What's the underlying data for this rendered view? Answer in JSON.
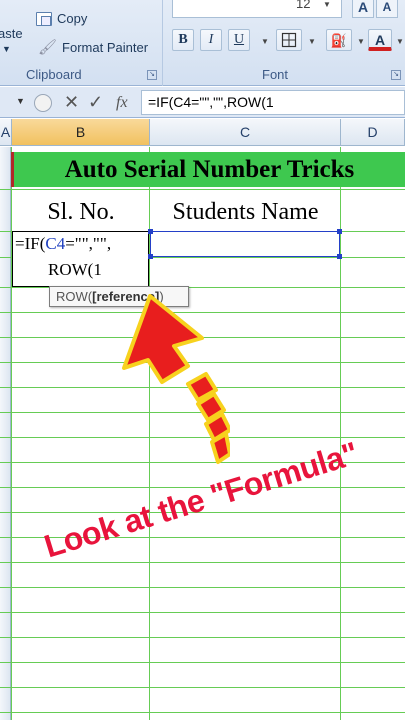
{
  "ribbon": {
    "paste_label": "aste",
    "copy_label": "Copy",
    "format_painter_label": "Format Painter",
    "clipboard_group": "Clipboard",
    "font_size": "12",
    "grow_label": "A",
    "shrink_label": "A",
    "bold_label": "B",
    "italic_label": "I",
    "underline_label": "U",
    "font_color_label": "A",
    "font_group": "Font"
  },
  "formula_bar": {
    "cancel_label": "✕",
    "enter_label": "✓",
    "fx_label": "fx",
    "formula": "=IF(C4=\"\",\"\",ROW(1"
  },
  "columns": [
    "A",
    "B",
    "C",
    "D"
  ],
  "sheet": {
    "title": "Auto Serial Number Tricks",
    "header_sl": "Sl. No.",
    "header_name": "Students Name",
    "edit_prefix": "=IF(",
    "edit_ref": "C4",
    "edit_suffix": "=\"\",\"\",",
    "edit_line2": "ROW(1"
  },
  "tooltip": {
    "prefix": "ROW(",
    "arg": "[reference]",
    "suffix": ")"
  },
  "overlay": {
    "caption": "Look at the \"Formula\""
  },
  "colors": {
    "title_band": "#3ec84f",
    "grid_lines": "#66cc55",
    "arrow_fill": "#e81e1e",
    "arrow_outline": "#f7d21e",
    "caption": "#e8143c",
    "reference_highlight": "#2440c8"
  }
}
